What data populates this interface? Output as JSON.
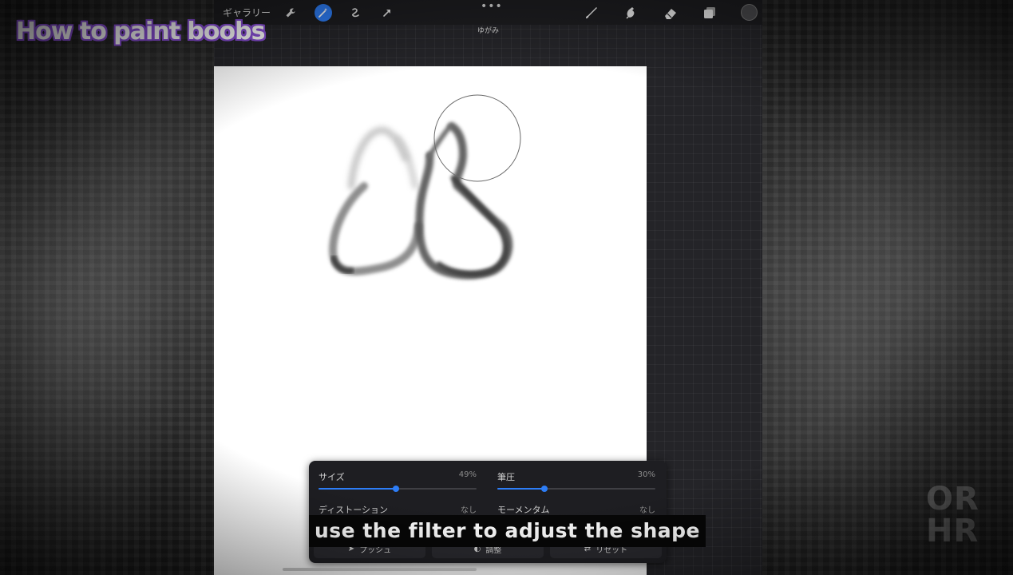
{
  "overlay": {
    "title": "How to paint boobs",
    "subtitle": "use the filter to adjust the shape",
    "watermark_line1": "OR",
    "watermark_line2": "HR"
  },
  "toolbar": {
    "gallery_label": "ギャラリー",
    "mode_label": "ゆがみ",
    "more_dots": "•••",
    "left_tools": [
      "wrench-icon",
      "magic-wand-icon",
      "selection-icon",
      "transform-arrow-icon"
    ],
    "right_tools": [
      "brush-icon",
      "smudge-icon",
      "eraser-icon",
      "layers-icon"
    ],
    "active_tool": "magic-wand-icon",
    "accent_color": "#2d7df6",
    "current_color": "#4a4a4d"
  },
  "panel": {
    "size": {
      "label": "サイズ",
      "value": "49%",
      "level": 0.49
    },
    "pressure": {
      "label": "筆圧",
      "value": "30%",
      "level": 0.3
    },
    "distortion": {
      "label": "ディストーション",
      "value": "なし"
    },
    "momentum": {
      "label": "モーメンタム",
      "value": "なし"
    },
    "push_label": "プッシュ",
    "adjust_label": "調整",
    "reset_label": "リセット"
  }
}
